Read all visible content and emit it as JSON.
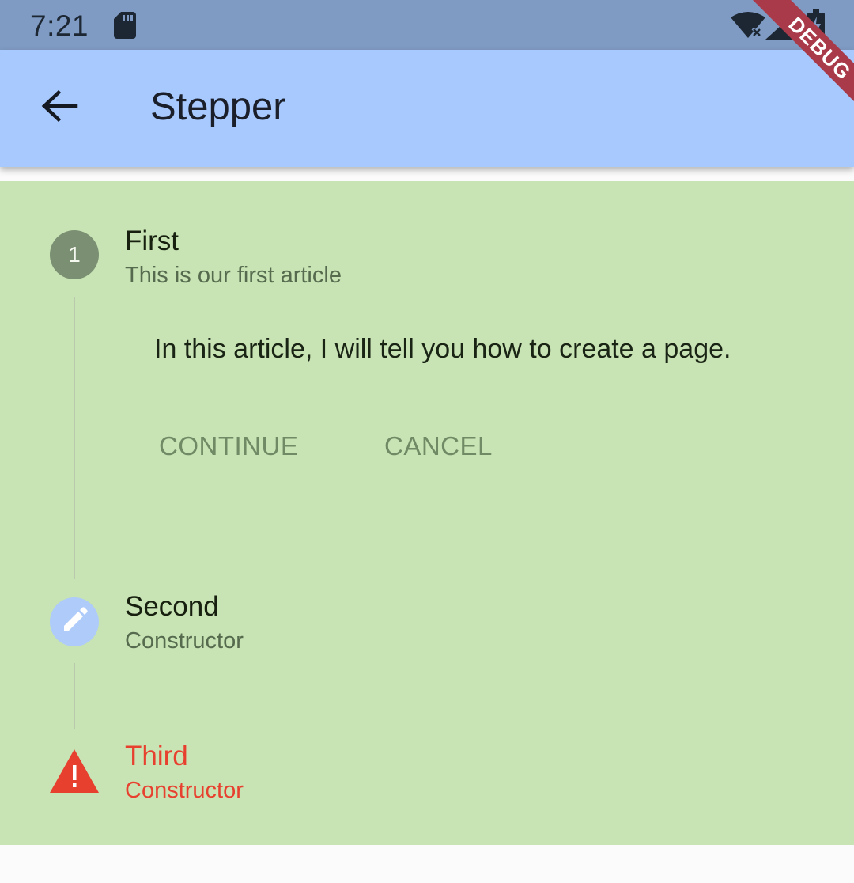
{
  "status_bar": {
    "time": "7:21",
    "icons": [
      "sd-card-icon",
      "wifi-off-icon",
      "signal-icon",
      "battery-charging-icon"
    ]
  },
  "app_bar": {
    "title": "Stepper",
    "back_icon": "arrow-back-icon"
  },
  "debug_banner": {
    "label": "DEBUG"
  },
  "stepper": {
    "steps": [
      {
        "title": "First",
        "subtitle": "This is our first article",
        "indicator": "1",
        "state": "indexed",
        "content": "In this article, I will tell you how to create a page."
      },
      {
        "title": "Second",
        "subtitle": "Constructor",
        "indicator": "edit-icon",
        "state": "editing"
      },
      {
        "title": "Third",
        "subtitle": "Constructor",
        "indicator": "warning-icon",
        "state": "error"
      }
    ],
    "controls": {
      "continue_label": "CONTINUE",
      "cancel_label": "CANCEL"
    }
  },
  "colors": {
    "status_bar": "#7f9bc3",
    "app_bar": "#a8c9fe",
    "content_bg": "#c8e3b4",
    "step_indexed": "#7b8f72",
    "step_editing": "#aecbfa",
    "error": "#e8402f",
    "button_text": "#6f8a64"
  }
}
